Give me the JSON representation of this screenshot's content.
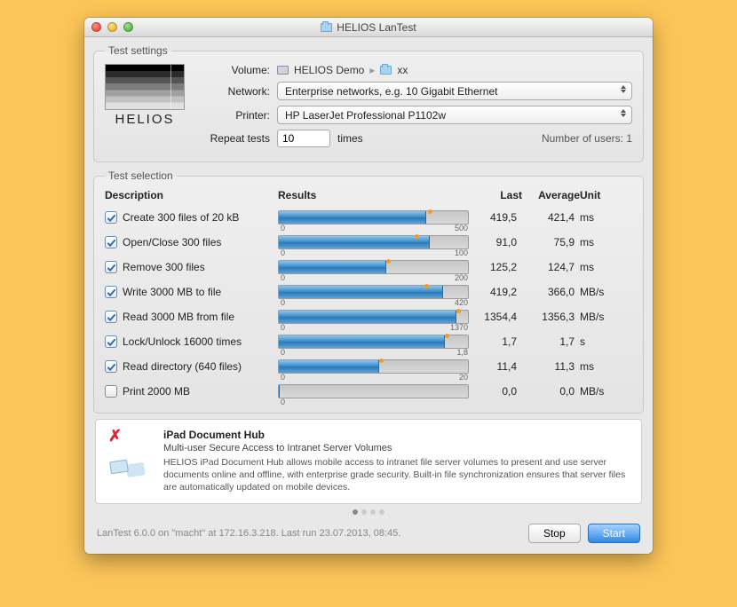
{
  "window_title": "HELIOS LanTest",
  "logo_text": "HELIOS",
  "settings": {
    "legend": "Test settings",
    "volume_label": "Volume:",
    "volume_root": "HELIOS Demo",
    "volume_sub": "xx",
    "network_label": "Network:",
    "network_value": "Enterprise networks, e.g. 10 Gigabit Ethernet",
    "printer_label": "Printer:",
    "printer_value": "HP LaserJet Professional P1102w",
    "repeat_label": "Repeat tests",
    "repeat_value": "10",
    "repeat_suffix": "times",
    "users_label": "Number of users: 1"
  },
  "selection": {
    "legend": "Test selection",
    "h_desc": "Description",
    "h_results": "Results",
    "h_last": "Last",
    "h_avg": "Average",
    "h_unit": "Unit",
    "tests": [
      {
        "on": true,
        "label": "Create 300 files of 20 kB",
        "fill": 78,
        "tick": 79,
        "max": "500",
        "last": "419,5",
        "avg": "421,4",
        "unit": "ms"
      },
      {
        "on": true,
        "label": "Open/Close 300 files",
        "fill": 80,
        "tick": 72,
        "max": "100",
        "last": "91,0",
        "avg": "75,9",
        "unit": "ms"
      },
      {
        "on": true,
        "label": "Remove 300 files",
        "fill": 57,
        "tick": 57,
        "max": "200",
        "last": "125,2",
        "avg": "124,7",
        "unit": "ms"
      },
      {
        "on": true,
        "label": "Write 3000 MB to file",
        "fill": 87,
        "tick": 77,
        "max": "420",
        "last": "419,2",
        "avg": "366,0",
        "unit": "MB/s"
      },
      {
        "on": true,
        "label": "Read 3000 MB from file",
        "fill": 94,
        "tick": 94,
        "max": "1370",
        "last": "1354,4",
        "avg": "1356,3",
        "unit": "MB/s"
      },
      {
        "on": true,
        "label": "Lock/Unlock 16000 times",
        "fill": 88,
        "tick": 88,
        "max": "1,8",
        "last": "1,7",
        "avg": "1,7",
        "unit": "s"
      },
      {
        "on": true,
        "label": "Read directory (640 files)",
        "fill": 53,
        "tick": 53,
        "max": "20",
        "last": "11,4",
        "avg": "11,3",
        "unit": "ms"
      },
      {
        "on": false,
        "label": "Print 2000 MB",
        "fill": 0,
        "tick": -1,
        "max": "",
        "last": "0,0",
        "avg": "0,0",
        "unit": "MB/s"
      }
    ]
  },
  "promo": {
    "title": "iPad Document Hub",
    "subtitle": "Multi-user Secure Access to Intranet Server Volumes",
    "body": "HELIOS iPad Document Hub allows mobile access to intranet file server volumes to present and use server documents online and offline, with enterprise grade security. Built-in file synchronization ensures that server files are automatically updated on mobile devices."
  },
  "footer": {
    "status": "LanTest 6.0.0 on \"macht\" at 172.16.3.218. Last run 23.07.2013, 08:45.",
    "stop": "Stop",
    "start": "Start"
  }
}
